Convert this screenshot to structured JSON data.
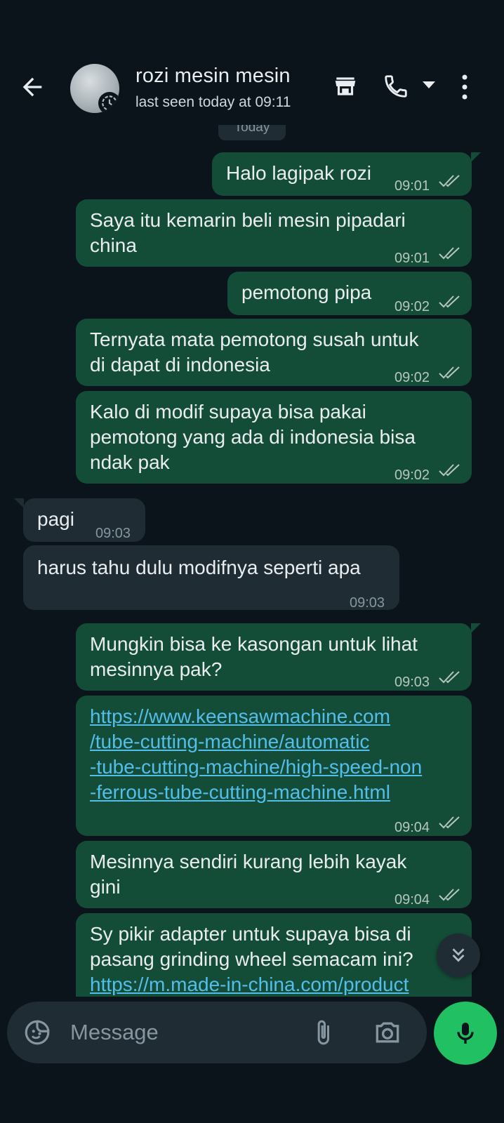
{
  "header": {
    "contact_name": "rozi mesin mesin",
    "status": "last seen today at 09:11",
    "day_label": "Today"
  },
  "messages": [
    {
      "dir": "out",
      "text": "Halo lagipak rozi",
      "time": "09:01"
    },
    {
      "dir": "out",
      "text": "Saya itu kemarin beli mesin pipadari\nchina",
      "time": "09:01"
    },
    {
      "dir": "out",
      "text": "pemotong pipa",
      "time": "09:02"
    },
    {
      "dir": "out",
      "text": "Ternyata mata pemotong susah untuk\ndi dapat di indonesia",
      "time": "09:02"
    },
    {
      "dir": "out",
      "text": "Kalo di modif supaya bisa pakai\npemotong yang ada di indonesia bisa\nndak pak",
      "time": "09:02"
    },
    {
      "dir": "in",
      "text": "pagi",
      "time": "09:03"
    },
    {
      "dir": "in",
      "text": "harus tahu dulu modifnya seperti apa",
      "time": "09:03"
    },
    {
      "dir": "out",
      "text": "Mungkin bisa ke kasongan untuk lihat\nmesinnya pak?",
      "time": "09:03"
    },
    {
      "dir": "out",
      "link": "https://www.keensawmachine.com\n/tube-cutting-machine/automatic\n-tube-cutting-machine/high-speed-non\n-ferrous-tube-cutting-machine.html",
      "time": "09:04"
    },
    {
      "dir": "out",
      "text": "Mesinnya sendiri kurang lebih kayak\ngini",
      "time": "09:04"
    },
    {
      "dir": "out",
      "text": "Sy pikir adapter untuk supaya bisa di\npasang grinding wheel semacam ini?",
      "link": "https://m.made-in-china.com/product"
    }
  ],
  "composer": {
    "placeholder": "Message"
  },
  "colors": {
    "background": "#0b141a",
    "outgoing_bubble": "#144d37",
    "incoming_bubble": "#1f2c33",
    "accent_green": "#21c063",
    "link": "#53bdeb",
    "read_ticks": "#b5c6bd"
  },
  "icons": [
    "back-arrow-icon",
    "status-ring-icon",
    "store-icon",
    "phone-icon",
    "caret-down-icon",
    "more-vert-icon",
    "double-check-icon",
    "scroll-down-icon",
    "sticker-icon",
    "attach-icon",
    "camera-icon",
    "mic-icon"
  ]
}
